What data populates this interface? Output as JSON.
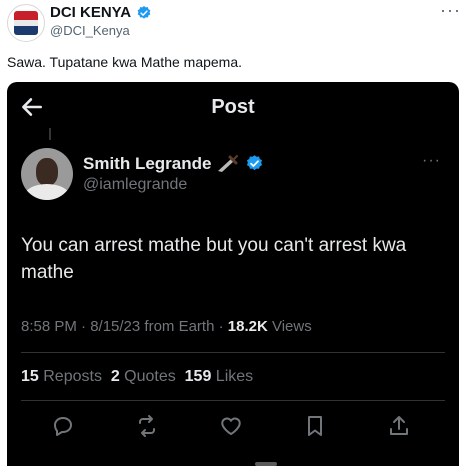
{
  "tweet": {
    "author_name": "DCI KENYA",
    "author_handle": "@DCI_Kenya",
    "text": "Sawa. Tupatane kwa Mathe mapema.",
    "more_icon": "more-horizontal-icon"
  },
  "screenshot": {
    "title": "Post",
    "back_icon": "arrow-left-icon",
    "author_name": "Smith Legrande",
    "author_emoji": "dagger",
    "author_handle": "@iamlegrande",
    "text": "You can arrest mathe but you can't arrest kwa mathe",
    "time_date": "8:58 PM · 8/15/23 from Earth · ",
    "views_count": "18.2K",
    "views_label": " Views",
    "reposts_count": "15",
    "reposts_label": " Reposts",
    "quotes_count": "2",
    "quotes_label": " Quotes",
    "likes_count": "159",
    "likes_label": " Likes",
    "actions": [
      "reply-icon",
      "repost-icon",
      "like-icon",
      "bookmark-icon",
      "share-icon"
    ]
  },
  "colors": {
    "verified_blue": "#1d9bf0",
    "dark_background": "#000000",
    "dark_text": "#e7e9ea",
    "muted_text": "#71767b"
  }
}
